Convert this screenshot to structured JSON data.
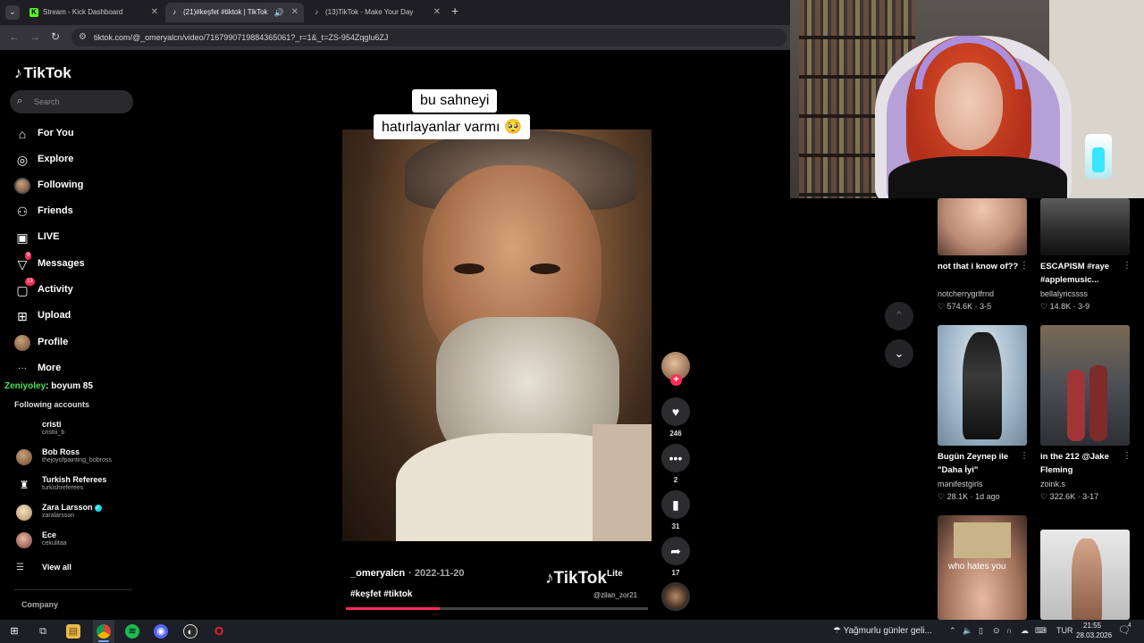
{
  "browser": {
    "tabs": [
      {
        "label": "Stream - Kick Dashboard",
        "favicon": "K",
        "color": "#53fc18"
      },
      {
        "label": "(21)#keşfet #tiktok | TikTok",
        "favicon": "♪",
        "color": "#ffffff"
      },
      {
        "label": "(13)TikTok - Make Your Day",
        "favicon": "♪",
        "color": "#ffffff"
      }
    ],
    "new_tab": "+",
    "url": "tiktok.com/@_omeryalcn/video/7167990719884365061?_r=1&_t=ZS-954Zqglu6ZJ"
  },
  "tiktok": {
    "logo": "TikTok",
    "search_placeholder": "Search",
    "nav": [
      {
        "label": "For You",
        "icon": "home-icon",
        "glyph": "⌂"
      },
      {
        "label": "Explore",
        "icon": "compass-icon",
        "glyph": "◎"
      },
      {
        "label": "Following",
        "icon": "following-avatar",
        "glyph": ""
      },
      {
        "label": "Friends",
        "icon": "friends-icon",
        "glyph": "⚇"
      },
      {
        "label": "LIVE",
        "icon": "live-icon",
        "glyph": "▣"
      },
      {
        "label": "Messages",
        "icon": "messages-icon",
        "glyph": "▽",
        "badge": "9"
      },
      {
        "label": "Activity",
        "icon": "activity-icon",
        "glyph": "▢",
        "badge": "13"
      },
      {
        "label": "Upload",
        "icon": "upload-icon",
        "glyph": "⊞"
      },
      {
        "label": "Profile",
        "icon": "profile-avatar",
        "glyph": ""
      },
      {
        "label": "More",
        "icon": "more-icon",
        "glyph": "···"
      }
    ],
    "chat": {
      "user": "Zeniyoley",
      "text": ": boyum 85"
    },
    "following_title": "Following accounts",
    "accounts": [
      {
        "name": "cristi",
        "handle": "cristiii_b",
        "verified": false
      },
      {
        "name": "Bob Ross",
        "handle": "thejoyofpainting_bobross",
        "verified": false
      },
      {
        "name": "Turkish Referees",
        "handle": "turkishreferees",
        "verified": false
      },
      {
        "name": "Zara Larsson",
        "handle": "zaralarsson",
        "verified": true
      },
      {
        "name": "Ece",
        "handle": "cekulitaa",
        "verified": false
      }
    ],
    "view_all": "View all",
    "company": "Company",
    "video": {
      "caption_line1": "bu sahneyi",
      "caption_line2": "hatırlayanlar varmı 🥺",
      "author": "_omeryalcn",
      "date": "· 2022-11-20",
      "tags": "#keşfet #tiktok",
      "watermark": "TikTok",
      "watermark_lite": "Lite",
      "watermark_handle": "@zilan_zor21",
      "progress": 0.31
    },
    "actions": {
      "likes": "246",
      "comments": "2",
      "saves": "31",
      "shares": "17"
    },
    "cards": [
      {
        "title": "not that i know of??",
        "user": "notcherrygrlfrnd",
        "stats": "♡ 574.6K · 3-5"
      },
      {
        "title": "ESCAPISM #raye #applemusic...",
        "user": "bellalyricssss",
        "stats": "♡ 14.8K · 3-9"
      },
      {
        "title": "Bugün Zeynep ile \"Daha İyi\"",
        "user": "mənifestgirls",
        "stats": "♡ 28.1K · 1d ago"
      },
      {
        "title": "in the 212 @Jake Fleming",
        "user": "zoink.s",
        "stats": "♡ 322.6K · 3-17"
      },
      {
        "title": "",
        "user": "",
        "stats": "",
        "thumb_text": "who hates you"
      }
    ]
  },
  "taskbar": {
    "weather": "Yağmurlu günler geli...",
    "lang": "TUR",
    "time": "21:55",
    "date": "28.03.2026",
    "notif": "4"
  }
}
